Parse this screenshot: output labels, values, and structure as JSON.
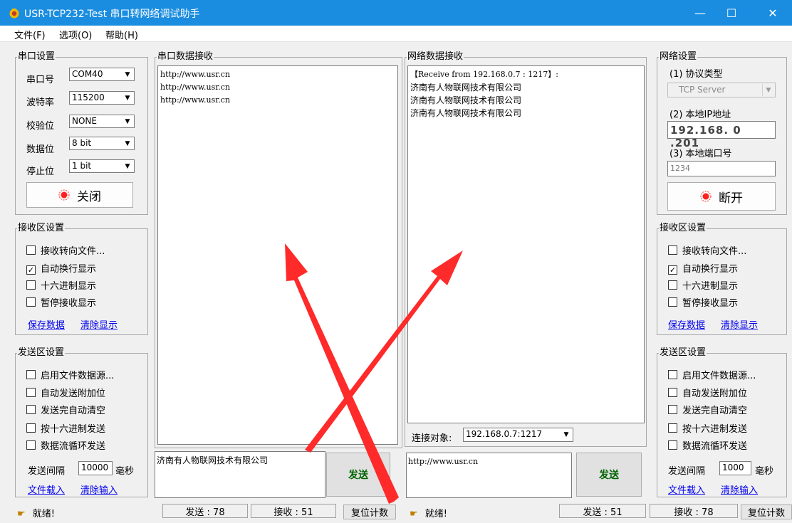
{
  "window": {
    "title": "USR-TCP232-Test 串口转网络调试助手",
    "minimize": "—",
    "maximize": "☐",
    "close": "✕"
  },
  "menu": [
    "文件(F)",
    "选项(O)",
    "帮助(H)"
  ],
  "serial_settings": {
    "title": "串口设置",
    "port_label": "串口号",
    "port_value": "COM40",
    "baud_label": "波特率",
    "baud_value": "115200",
    "parity_label": "校验位",
    "parity_value": "NONE",
    "databits_label": "数据位",
    "databits_value": "8 bit",
    "stopbits_label": "停止位",
    "stopbits_value": "1 bit",
    "toggle_label": "关闭"
  },
  "left_receive_settings": {
    "title": "接收区设置",
    "options": [
      {
        "label": "接收转向文件...",
        "checked": false
      },
      {
        "label": "自动换行显示",
        "checked": true
      },
      {
        "label": "十六进制显示",
        "checked": false
      },
      {
        "label": "暂停接收显示",
        "checked": false
      }
    ],
    "save_link": "保存数据",
    "clear_link": "清除显示"
  },
  "left_send_settings": {
    "title": "发送区设置",
    "options": [
      {
        "label": "启用文件数据源...",
        "checked": false
      },
      {
        "label": "自动发送附加位",
        "checked": false
      },
      {
        "label": "发送完自动清空",
        "checked": false
      },
      {
        "label": "按十六进制发送",
        "checked": false
      },
      {
        "label": "数据流循环发送",
        "checked": false
      }
    ],
    "interval_label": "发送间隔",
    "interval_value": "10000",
    "interval_unit": "毫秒",
    "load_link": "文件载入",
    "clear_link": "清除输入"
  },
  "serial_receive": {
    "title": "串口数据接收",
    "lines": [
      "http://www.usr.cn",
      "http://www.usr.cn",
      "http://www.usr.cn"
    ]
  },
  "serial_send": {
    "text": "济南有人物联网技术有限公司",
    "send_label": "发送"
  },
  "net_receive": {
    "title": "网络数据接收",
    "lines": [
      "【Receive from 192.168.0.7 : 1217】:",
      "济南有人物联网技术有限公司",
      "济南有人物联网技术有限公司",
      "济南有人物联网技术有限公司"
    ]
  },
  "connection": {
    "label": "连接对象:",
    "value": "192.168.0.7:1217"
  },
  "net_send": {
    "text": "http://www.usr.cn",
    "send_label": "发送"
  },
  "net_settings": {
    "title": "网络设置",
    "protocol_label": "(1) 协议类型",
    "protocol_value": "TCP Server",
    "ip_label": "(2) 本地IP地址",
    "ip_value": "192.168. 0 .201",
    "port_label": "(3) 本地端口号",
    "port_value": "1234",
    "toggle_label": "断开"
  },
  "right_receive_settings": {
    "title": "接收区设置",
    "options": [
      {
        "label": "接收转向文件...",
        "checked": false
      },
      {
        "label": "自动换行显示",
        "checked": true
      },
      {
        "label": "十六进制显示",
        "checked": false
      },
      {
        "label": "暂停接收显示",
        "checked": false
      }
    ],
    "save_link": "保存数据",
    "clear_link": "清除显示"
  },
  "right_send_settings": {
    "title": "发送区设置",
    "options": [
      {
        "label": "启用文件数据源...",
        "checked": false
      },
      {
        "label": "自动发送附加位",
        "checked": false
      },
      {
        "label": "发送完自动清空",
        "checked": false
      },
      {
        "label": "按十六进制发送",
        "checked": false
      },
      {
        "label": "数据流循环发送",
        "checked": false
      }
    ],
    "interval_label": "发送间隔",
    "interval_value": "1000",
    "interval_unit": "毫秒",
    "load_link": "文件载入",
    "clear_link": "清除输入"
  },
  "status_left": {
    "ready": "就绪!",
    "sent": "发送 : 78",
    "received": "接收 : 51",
    "reset": "复位计数"
  },
  "status_right": {
    "ready": "就绪!",
    "sent": "发送 : 51",
    "received": "接收 : 78",
    "reset": "复位计数"
  },
  "colors": {
    "titlebar": "#1a8de0",
    "arrow": "#ff2a2a",
    "send_text": "#006400",
    "link": "#0000ee"
  }
}
